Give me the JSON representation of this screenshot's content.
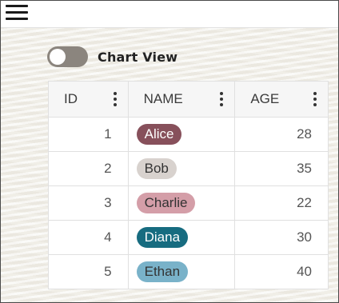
{
  "header": {
    "menu_icon": "hamburger-menu-icon"
  },
  "view_toggle": {
    "label": "Chart View",
    "checked": false
  },
  "table": {
    "columns": [
      {
        "key": "id",
        "label": "ID"
      },
      {
        "key": "name",
        "label": "NAME"
      },
      {
        "key": "age",
        "label": "AGE"
      }
    ],
    "column_menu_icon": "kebab-menu-icon",
    "rows": [
      {
        "id": "1",
        "name": "Alice",
        "age": "28",
        "pill_bg": "#87505b",
        "pill_fg": "#ffffff"
      },
      {
        "id": "2",
        "name": "Bob",
        "age": "35",
        "pill_bg": "#d8d2ce",
        "pill_fg": "#333333"
      },
      {
        "id": "3",
        "name": "Charlie",
        "age": "22",
        "pill_bg": "#d49ea8",
        "pill_fg": "#333333"
      },
      {
        "id": "4",
        "name": "Diana",
        "age": "30",
        "pill_bg": "#176c80",
        "pill_fg": "#ffffff"
      },
      {
        "id": "5",
        "name": "Ethan",
        "age": "40",
        "pill_bg": "#79b2c9",
        "pill_fg": "#333333"
      }
    ]
  }
}
